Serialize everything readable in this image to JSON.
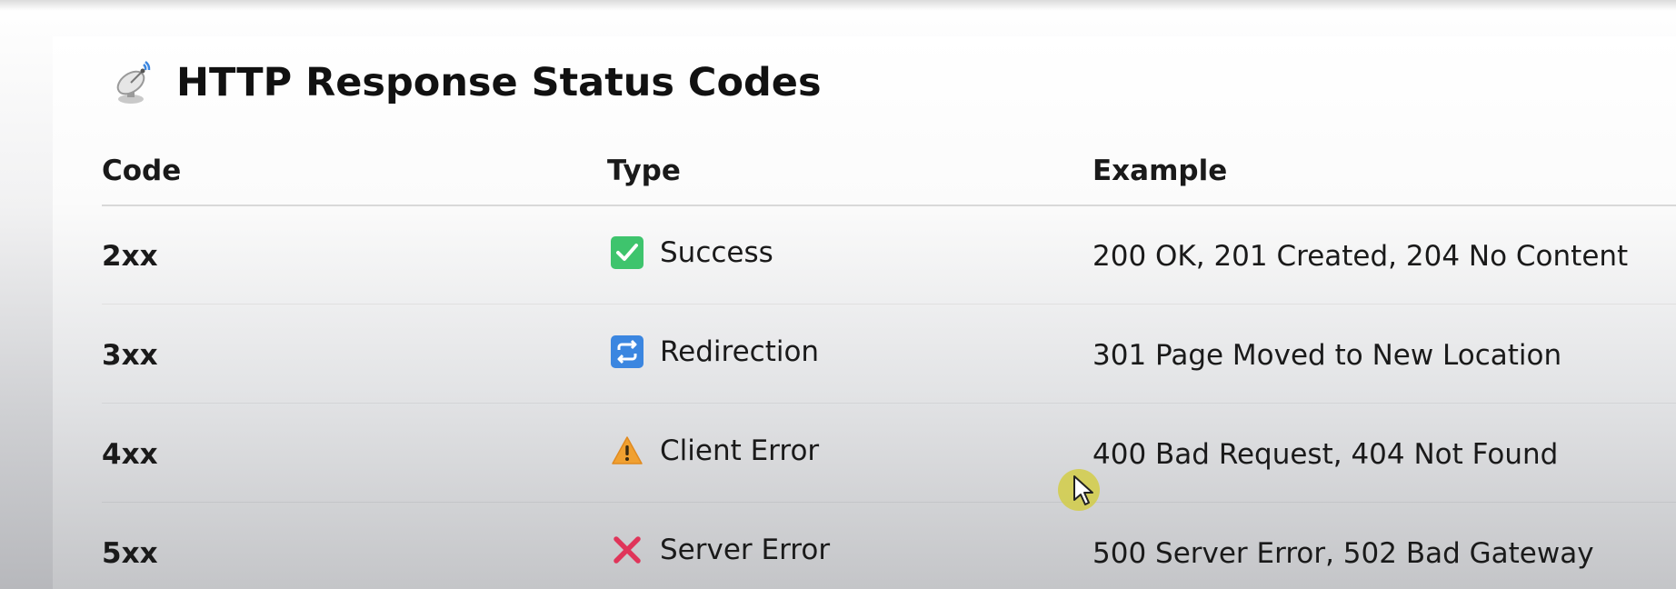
{
  "header": {
    "title": "HTTP Response Status Codes",
    "icon": "satellite-antenna-icon"
  },
  "table": {
    "columns": [
      "Code",
      "Type",
      "Example"
    ],
    "rows": [
      {
        "code": "2xx",
        "type": "Success",
        "icon": "check-mark-icon",
        "icon_color": "#3ec46d",
        "example": "200 OK, 201 Created, 204 No Content"
      },
      {
        "code": "3xx",
        "type": "Redirection",
        "icon": "repeat-arrows-icon",
        "icon_color": "#3b86e0",
        "example": "301 Page Moved to New Location"
      },
      {
        "code": "4xx",
        "type": "Client Error",
        "icon": "warning-icon",
        "icon_color": "#f0a030",
        "example": "400 Bad Request, 404 Not Found"
      },
      {
        "code": "5xx",
        "type": "Server Error",
        "icon": "cross-mark-icon",
        "icon_color": "#e0355a",
        "example": "500 Server Error, 502 Bad Gateway"
      }
    ]
  },
  "cursor": {
    "icon": "mouse-pointer-icon",
    "highlight_color": "#d2cd46"
  }
}
